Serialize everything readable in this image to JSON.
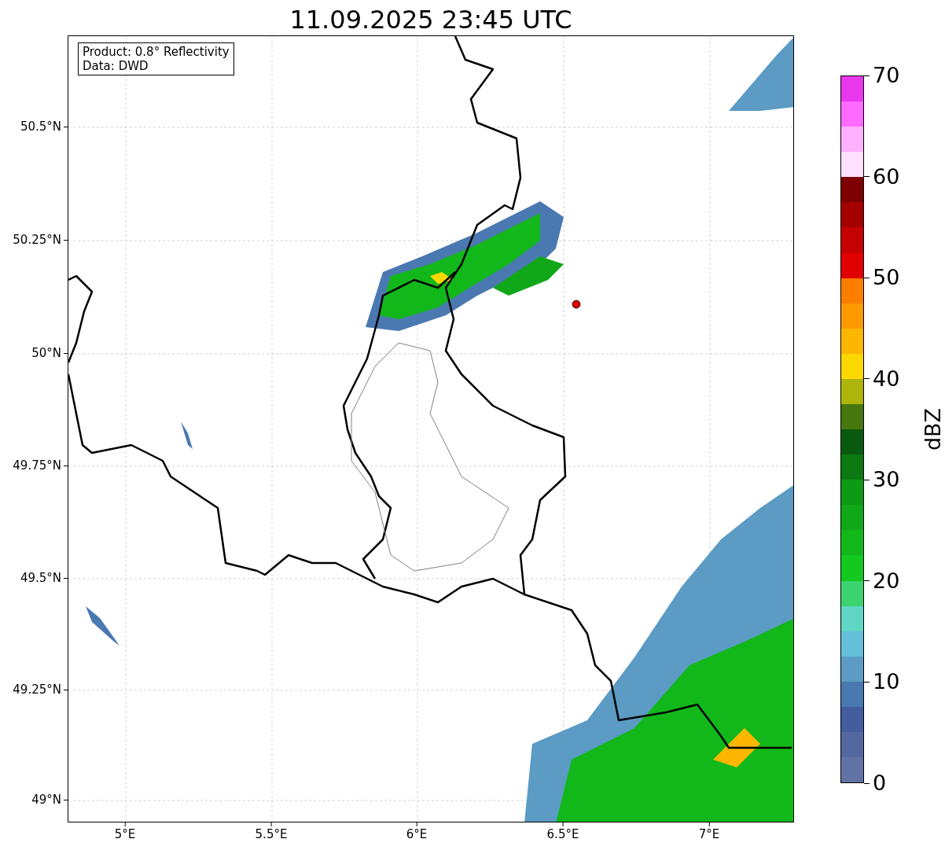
{
  "title": "11.09.2025 23:45 UTC",
  "info_box": [
    "Product: 0.8° Reflectivity",
    "Data: DWD"
  ],
  "y_ticks": [
    "50.5°N",
    "50.25°N",
    "50°N",
    "49.75°N",
    "49.5°N",
    "49.25°N",
    "49°N"
  ],
  "x_ticks": [
    "5°E",
    "5.5°E",
    "6°E",
    "6.5°E",
    "7°E"
  ],
  "colorbar": {
    "label": "dBZ",
    "ticks": [
      "70",
      "60",
      "50",
      "40",
      "30",
      "20",
      "10",
      "0"
    ],
    "bins": [
      {
        "color": "#e937ee"
      },
      {
        "color": "#ff6aff"
      },
      {
        "color": "#ffb0ff"
      },
      {
        "color": "#ffe0ff"
      },
      {
        "color": "#7c0000"
      },
      {
        "color": "#a40000"
      },
      {
        "color": "#c40000"
      },
      {
        "color": "#e10000"
      },
      {
        "color": "#fd7d00"
      },
      {
        "color": "#fd9a00"
      },
      {
        "color": "#fdb700"
      },
      {
        "color": "#fdd700"
      },
      {
        "color": "#adb40b"
      },
      {
        "color": "#46780e"
      },
      {
        "color": "#085a10"
      },
      {
        "color": "#0b7a12"
      },
      {
        "color": "#0d9a15"
      },
      {
        "color": "#10a818"
      },
      {
        "color": "#12b81a"
      },
      {
        "color": "#13c81e"
      },
      {
        "color": "#3dd370"
      },
      {
        "color": "#5fd6c4"
      },
      {
        "color": "#64c0d8"
      },
      {
        "color": "#5b9bc4"
      },
      {
        "color": "#4a78b0"
      },
      {
        "color": "#445d9f"
      },
      {
        "color": "#5468a0"
      },
      {
        "color": "#6272a4"
      }
    ]
  }
}
